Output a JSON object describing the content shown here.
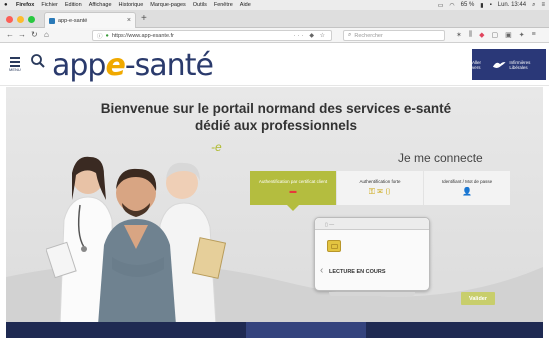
{
  "os_menu": {
    "apple": "",
    "app_name": "Firefox",
    "items": [
      "Fichier",
      "Edition",
      "Affichage",
      "Historique",
      "Marque-pages",
      "Outils",
      "Fenêtre",
      "Aide"
    ],
    "battery": "65 %",
    "clock": "Lun. 13:44"
  },
  "browser": {
    "tab_title": "app-e-santé",
    "url": "https://www.app-esante.fr",
    "search_placeholder": "Rechercher"
  },
  "site": {
    "menu_label": "MENU",
    "logo_left": "app",
    "logo_e": "e",
    "logo_right": "-santé",
    "partner_prefix": "Aller vers",
    "partner_name": "Infirmières Libérales"
  },
  "hero": {
    "welcome_line1": "Bienvenue sur le portail normand des services e-santé",
    "welcome_line2": "dédié aux professionnels",
    "accent": "-e"
  },
  "login": {
    "title": "Je me connecte",
    "tabs": [
      {
        "label": "Authentification par certificat client",
        "icon": "card-icon",
        "active": true
      },
      {
        "label": "Authentification forte",
        "icon": "key-mail-phone-icon",
        "active": false
      },
      {
        "label": "Identifiant / Mot de passe",
        "icon": "user-key-icon",
        "active": false
      }
    ],
    "reader_status": "LECTURE EN COURS",
    "validate_label": "Valider"
  },
  "colors": {
    "brand_navy": "#2a3a6c",
    "accent_yellow": "#f0a900",
    "tab_active_green": "#b4bd3f",
    "validate_green": "#c8ce6c"
  }
}
